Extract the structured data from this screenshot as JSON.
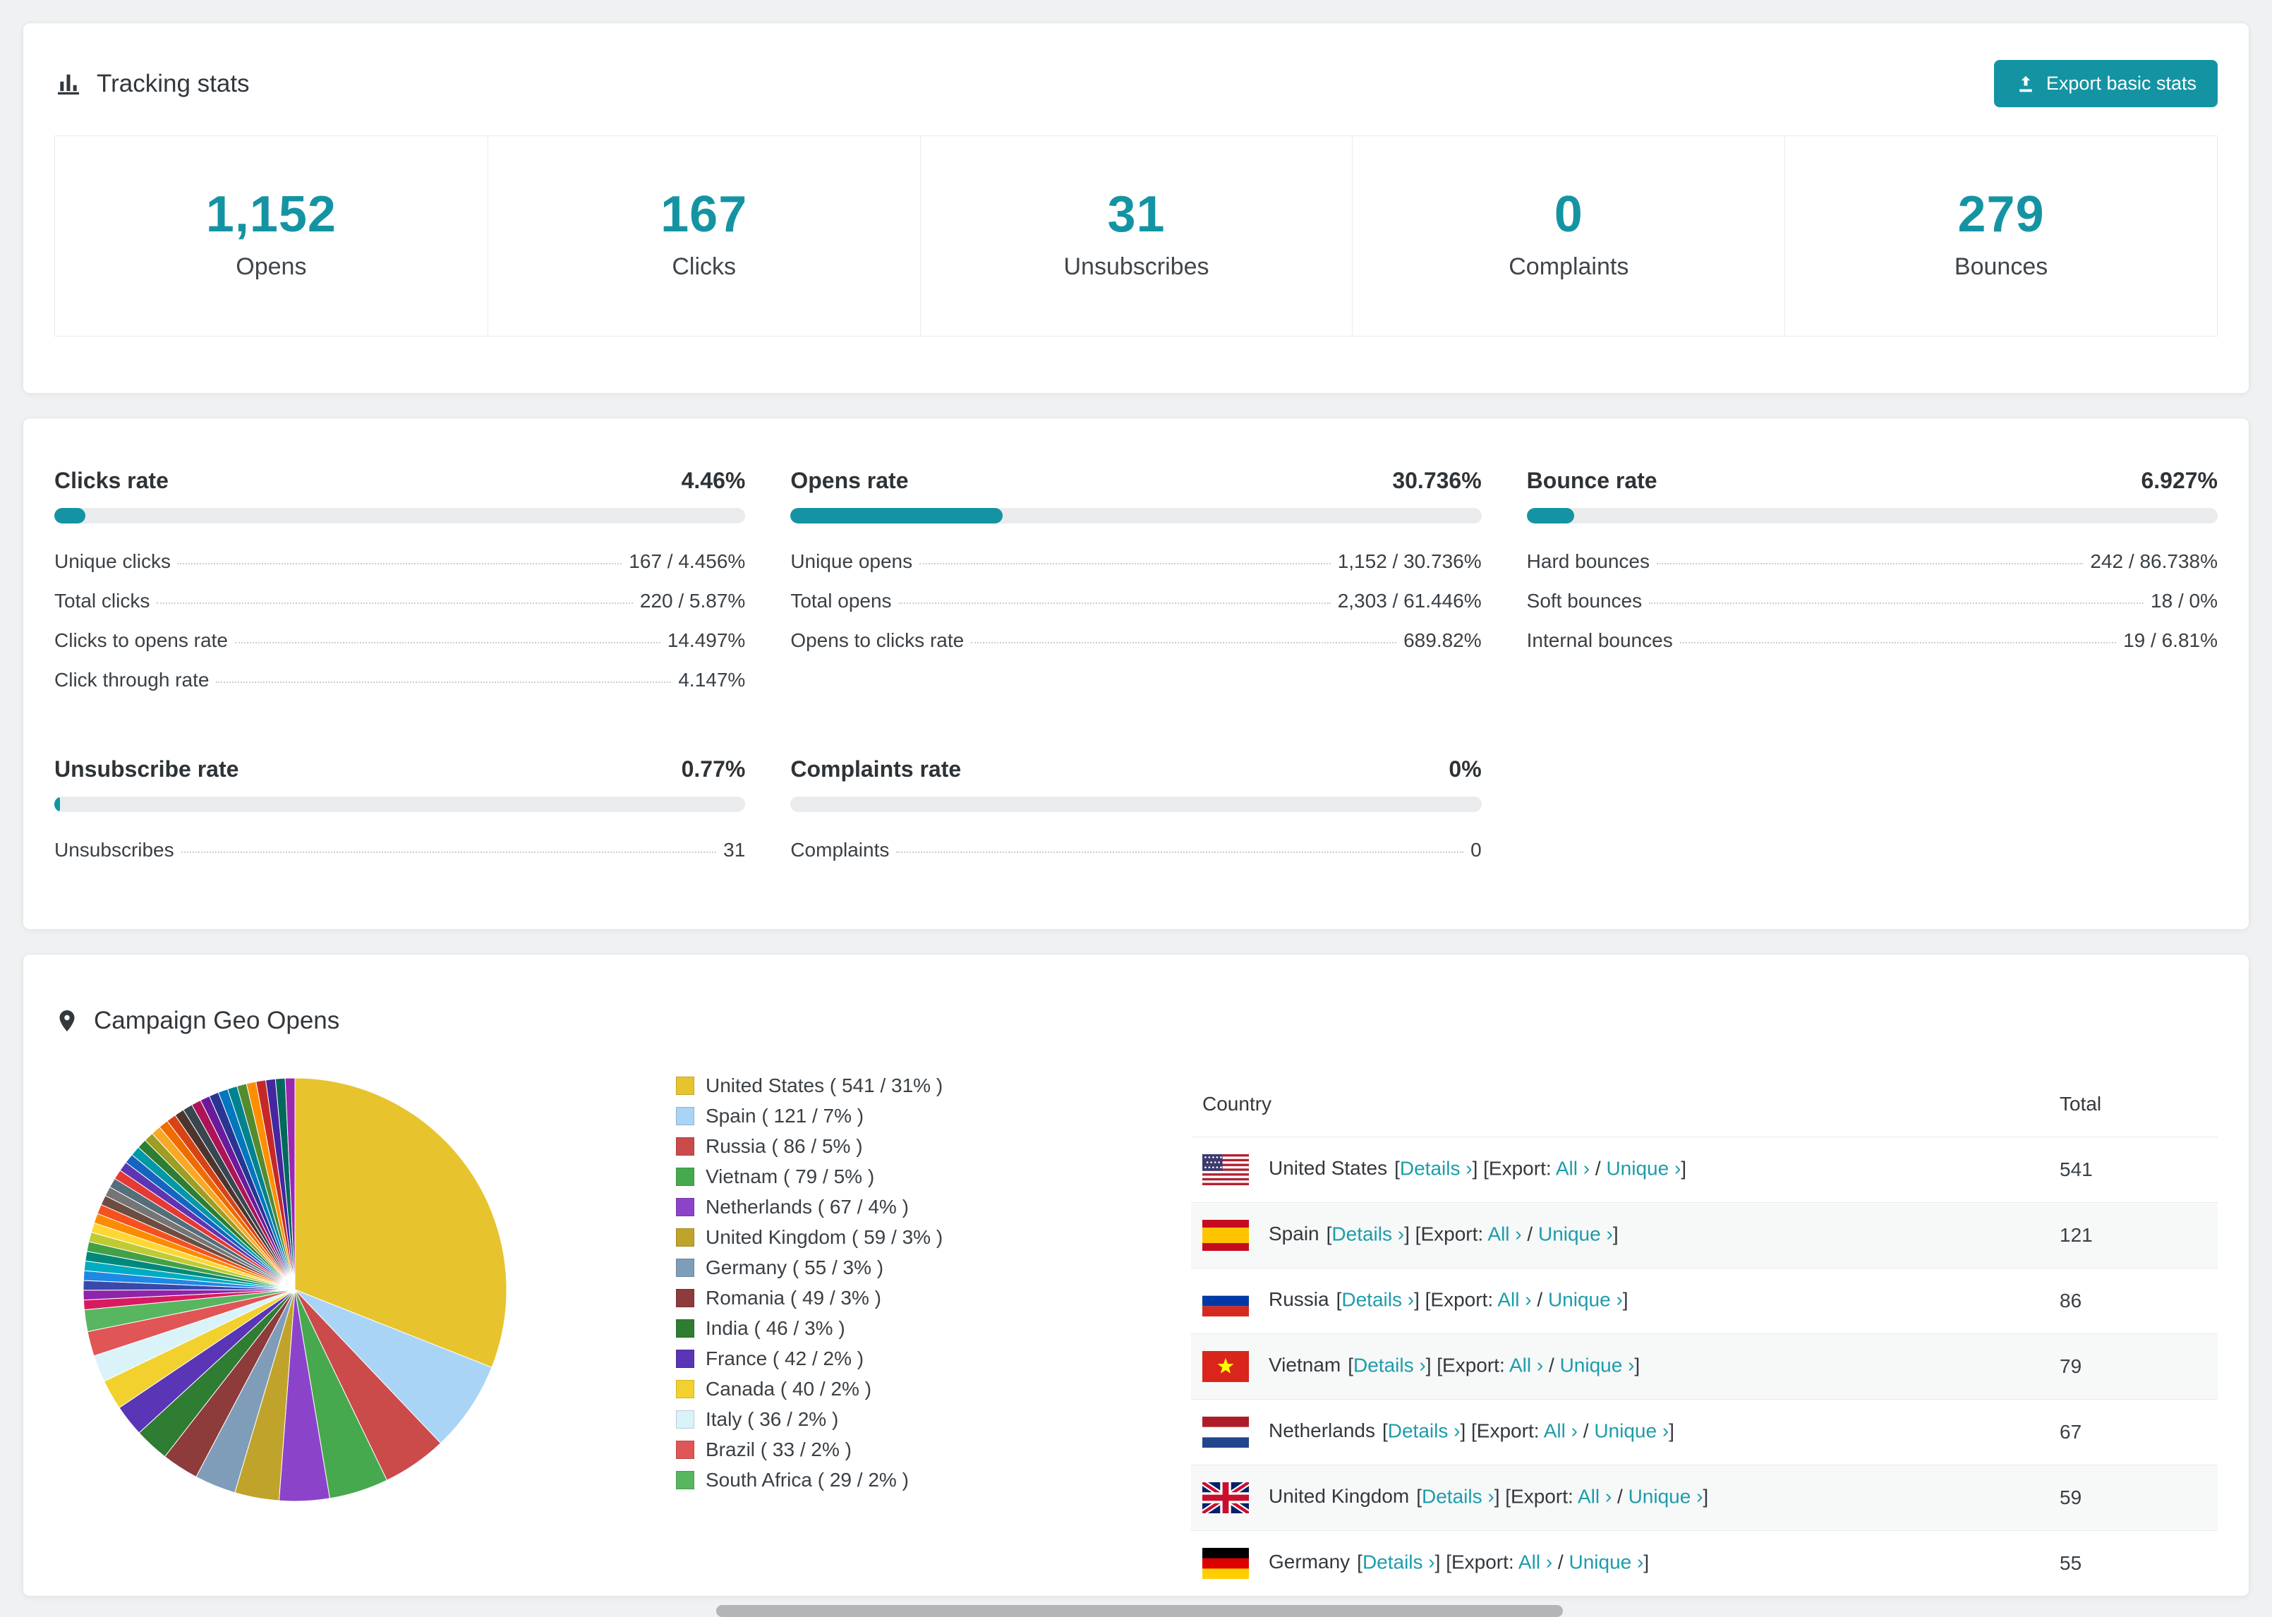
{
  "colors": {
    "accent": "#1494a3",
    "link": "#1d9cab",
    "bar_background": "#e9ebec",
    "page_background": "#eff1f2"
  },
  "tracking": {
    "title": "Tracking stats",
    "export_button": "Export basic stats",
    "stats": [
      {
        "value": "1,152",
        "label": "Opens"
      },
      {
        "value": "167",
        "label": "Clicks"
      },
      {
        "value": "31",
        "label": "Unsubscribes"
      },
      {
        "value": "0",
        "label": "Complaints"
      },
      {
        "value": "279",
        "label": "Bounces"
      }
    ]
  },
  "rates": [
    {
      "title": "Clicks rate",
      "value": "4.46%",
      "pct": 4.46,
      "rows": [
        {
          "label": "Unique clicks",
          "value": "167 / 4.456%"
        },
        {
          "label": "Total clicks",
          "value": "220 / 5.87%"
        },
        {
          "label": "Clicks to opens rate",
          "value": "14.497%"
        },
        {
          "label": "Click through rate",
          "value": "4.147%"
        }
      ]
    },
    {
      "title": "Opens rate",
      "value": "30.736%",
      "pct": 30.736,
      "rows": [
        {
          "label": "Unique opens",
          "value": "1,152 / 30.736%"
        },
        {
          "label": "Total opens",
          "value": "2,303 / 61.446%"
        },
        {
          "label": "Opens to clicks rate",
          "value": "689.82%"
        }
      ]
    },
    {
      "title": "Bounce rate",
      "value": "6.927%",
      "pct": 6.927,
      "rows": [
        {
          "label": "Hard bounces",
          "value": "242 / 86.738%"
        },
        {
          "label": "Soft bounces",
          "value": "18 / 0%"
        },
        {
          "label": "Internal bounces",
          "value": "19 / 6.81%"
        }
      ]
    },
    {
      "title": "Unsubscribe rate",
      "value": "0.77%",
      "pct": 0.77,
      "rows": [
        {
          "label": "Unsubscribes",
          "value": "31"
        }
      ]
    },
    {
      "title": "Complaints rate",
      "value": "0%",
      "pct": 0,
      "rows": [
        {
          "label": "Complaints",
          "value": "0"
        }
      ]
    }
  ],
  "geo": {
    "title": "Campaign Geo Opens",
    "table": {
      "headers": {
        "country": "Country",
        "total": "Total"
      },
      "link_labels": {
        "details": "Details ›",
        "export": "Export:",
        "all": "All ›",
        "unique": "Unique ›",
        "bracket_open": "[",
        "bracket_close": "]",
        "slash": "/"
      },
      "rows": [
        {
          "country": "United States",
          "flag": "us",
          "total": 541
        },
        {
          "country": "Spain",
          "flag": "es",
          "total": 121
        },
        {
          "country": "Russia",
          "flag": "ru",
          "total": 86
        },
        {
          "country": "Vietnam",
          "flag": "vn",
          "total": 79
        },
        {
          "country": "Netherlands",
          "flag": "nl",
          "total": 67
        },
        {
          "country": "United Kingdom",
          "flag": "gb",
          "total": 59
        },
        {
          "country": "Germany",
          "flag": "de",
          "total": 55
        }
      ]
    }
  },
  "chart_data": {
    "type": "pie",
    "title": "Campaign Geo Opens",
    "legend_position": "right",
    "legend_format": "Label ( value / pct% )",
    "slices": [
      {
        "label": "United States",
        "value": 541,
        "pct": 31,
        "color": "#e7c32d"
      },
      {
        "label": "Spain",
        "value": 121,
        "pct": 7,
        "color": "#a9d4f5"
      },
      {
        "label": "Russia",
        "value": 86,
        "pct": 5,
        "color": "#cb4b4b"
      },
      {
        "label": "Vietnam",
        "value": 79,
        "pct": 5,
        "color": "#47a94e"
      },
      {
        "label": "Netherlands",
        "value": 67,
        "pct": 4,
        "color": "#8b44c9"
      },
      {
        "label": "United Kingdom",
        "value": 59,
        "pct": 3,
        "color": "#c0a32b"
      },
      {
        "label": "Germany",
        "value": 55,
        "pct": 3,
        "color": "#7f9db9"
      },
      {
        "label": "Romania",
        "value": 49,
        "pct": 3,
        "color": "#8e3b3b"
      },
      {
        "label": "India",
        "value": 46,
        "pct": 3,
        "color": "#2e7d32"
      },
      {
        "label": "France",
        "value": 42,
        "pct": 2,
        "color": "#5a35b5"
      },
      {
        "label": "Canada",
        "value": 40,
        "pct": 2,
        "color": "#f2d12f"
      },
      {
        "label": "Italy",
        "value": 36,
        "pct": 2,
        "color": "#d9f3f9"
      },
      {
        "label": "Brazil",
        "value": 33,
        "pct": 2,
        "color": "#e05555"
      },
      {
        "label": "South Africa",
        "value": 29,
        "pct": 2,
        "color": "#57b65f"
      }
    ],
    "unlabeled_remainder": {
      "value": 463,
      "slice_count": 36,
      "palette": [
        "#d81b60",
        "#8e24aa",
        "#3949ab",
        "#1e88e5",
        "#00acc1",
        "#00897b",
        "#43a047",
        "#c0ca33",
        "#fdd835",
        "#fb8c00",
        "#f4511e",
        "#6d4c41",
        "#757575",
        "#546e7a",
        "#e53935",
        "#5e35b1",
        "#1565c0",
        "#0097a7",
        "#2e7d32",
        "#9e9d24",
        "#f9a825",
        "#ef6c00",
        "#d84315",
        "#4e342e",
        "#37474f",
        "#ad1457",
        "#6a1b9a",
        "#283593",
        "#0277bd",
        "#00838f",
        "#558b2f",
        "#ff8f00",
        "#c62828",
        "#4527a0",
        "#00695c",
        "#9c27b0"
      ]
    }
  }
}
